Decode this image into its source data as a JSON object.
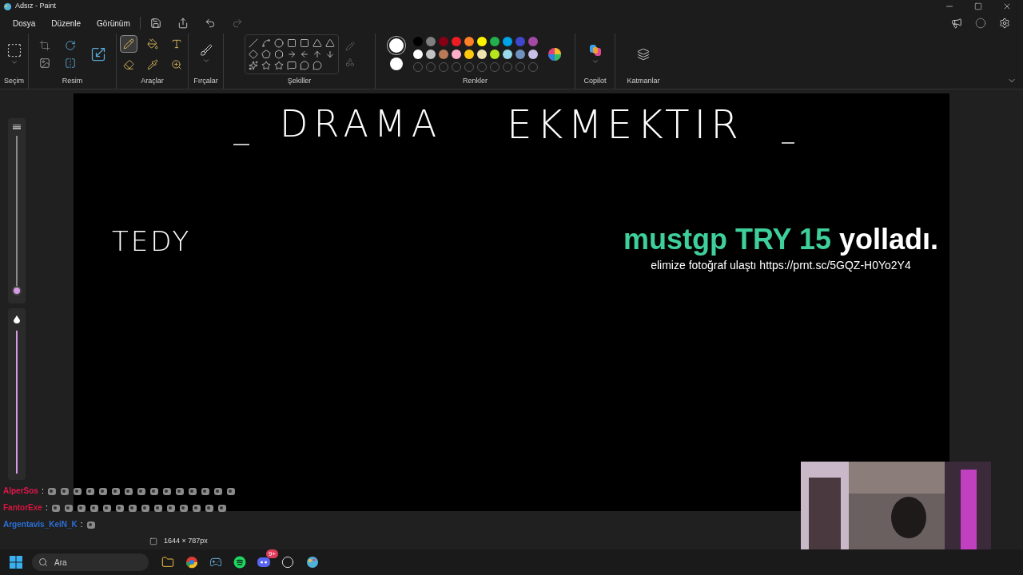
{
  "window": {
    "title": "Adsız - Paint"
  },
  "menu": [
    {
      "label": "Dosya"
    },
    {
      "label": "Düzenle"
    },
    {
      "label": "Görünüm"
    }
  ],
  "ribbon": {
    "groups": [
      {
        "label": "Seçim"
      },
      {
        "label": "Resim"
      },
      {
        "label": "Araçlar"
      },
      {
        "label": "Fırçalar"
      },
      {
        "label": "Şekiller"
      },
      {
        "label": "Renkler"
      },
      {
        "label": "Copilot"
      },
      {
        "label": "Katmanlar"
      }
    ],
    "tools": [
      {
        "kind": "pencil",
        "selected": true
      },
      {
        "kind": "fill",
        "selected": false
      },
      {
        "kind": "text",
        "selected": false
      },
      {
        "kind": "eraser",
        "selected": false
      },
      {
        "kind": "picker",
        "selected": false
      },
      {
        "kind": "zoom",
        "selected": false
      }
    ],
    "palette": [
      {
        "color": "#000000"
      },
      {
        "color": "#7f7f7f"
      },
      {
        "color": "#880015"
      },
      {
        "color": "#ed1c24"
      },
      {
        "color": "#ff7f27"
      },
      {
        "color": "#fff200"
      },
      {
        "color": "#22b14c"
      },
      {
        "color": "#00a2e8"
      },
      {
        "color": "#3f48cc"
      },
      {
        "color": "#a349a4"
      },
      {
        "color": "#ffffff"
      },
      {
        "color": "#c3c3c3"
      },
      {
        "color": "#b97a57"
      },
      {
        "color": "#ffaec9"
      },
      {
        "color": "#ffc90e"
      },
      {
        "color": "#efe4b0"
      },
      {
        "color": "#b5e61d"
      },
      {
        "color": "#99d9ea"
      },
      {
        "color": "#7092be"
      },
      {
        "color": "#c8bfe7"
      }
    ],
    "color1": {
      "color": "#ffffff"
    },
    "color2": {
      "color": "#ffffff"
    }
  },
  "sliders": {
    "size": {
      "level": 0.0
    },
    "opacity": {
      "level": 1.0
    }
  },
  "canvas": {
    "texts": [
      {
        "kind": "title",
        "text": "DRAMA"
      },
      {
        "kind": "title",
        "text": "EKMEKTIR"
      },
      {
        "kind": "side",
        "text": "TEDY"
      }
    ]
  },
  "donation": {
    "name": "mustgp",
    "amount": "TRY 15",
    "action": "yolladı.",
    "message": "elimize fotoğraf ulaştı https://prnt.sc/5GQZ-H0Yo2Y4"
  },
  "status_bar": {
    "canvas_size": "1644 × 787px"
  },
  "chat": [
    {
      "user": "AlperSos",
      "color": "#e0174a",
      "separator": ":"
    },
    {
      "user": "FantorExe",
      "color": "#d6163f",
      "separator": ":"
    },
    {
      "user": "Argentavis_KeiN_K",
      "color": "#2b6fd6",
      "separator": ":"
    }
  ],
  "taskbar": {
    "search": {
      "placeholder": "Ara"
    },
    "discord_badge": "9+"
  }
}
